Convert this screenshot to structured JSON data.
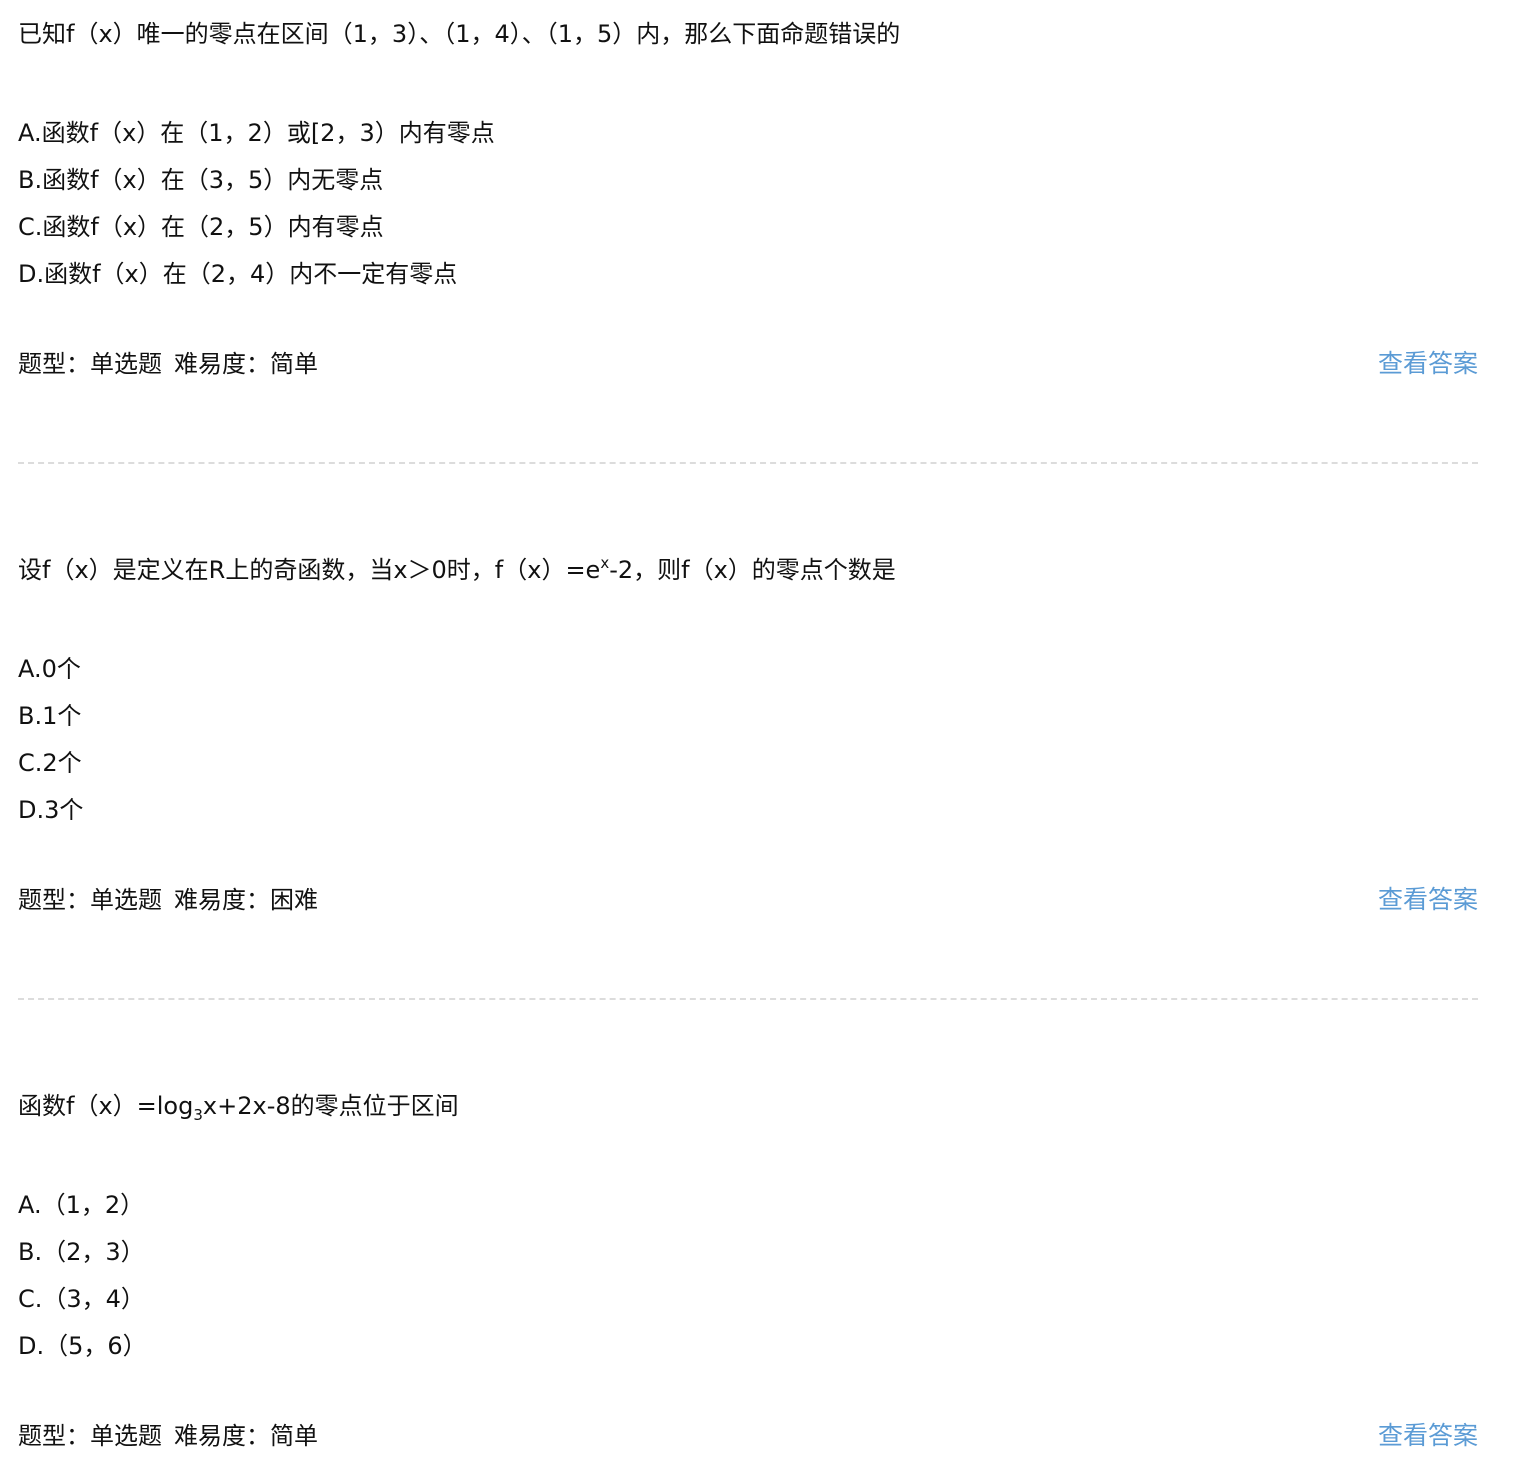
{
  "questions": [
    {
      "stem": "已知f（x）唯一的零点在区间（1，3）、（1，4）、（1，5）内，那么下面命题错误的",
      "options": [
        "A.函数f（x）在（1，2）或[2，3）内有零点",
        "B.函数f（x）在（3，5）内无零点",
        "C.函数f（x）在（2，5）内有零点",
        "D.函数f（x）在（2，4）内不一定有零点"
      ],
      "type_label": "题型：单选题",
      "difficulty_label": "难易度：简单",
      "answer_link": "查看答案"
    },
    {
      "stem_parts": {
        "before": "设f（x）是定义在R上的奇函数，当x＞0时，f（x）=e",
        "sup": "x",
        "after": "-2，则f（x）的零点个数是"
      },
      "options": [
        "A.0个",
        "B.1个",
        "C.2个",
        "D.3个"
      ],
      "type_label": "题型：单选题",
      "difficulty_label": "难易度：困难",
      "answer_link": "查看答案"
    },
    {
      "stem_parts": {
        "before": "函数f（x）=log",
        "sub": "3",
        "after": "x+2x-8的零点位于区间"
      },
      "options": [
        "A.（1，2）",
        "B.（2，3）",
        "C.（3，4）",
        "D.（5，6）"
      ],
      "type_label": "题型：单选题",
      "difficulty_label": "难易度：简单",
      "answer_link": "查看答案"
    }
  ],
  "colors": {
    "text": "#111111",
    "link": "#5b9bd5",
    "divider": "#dcdcdc"
  }
}
